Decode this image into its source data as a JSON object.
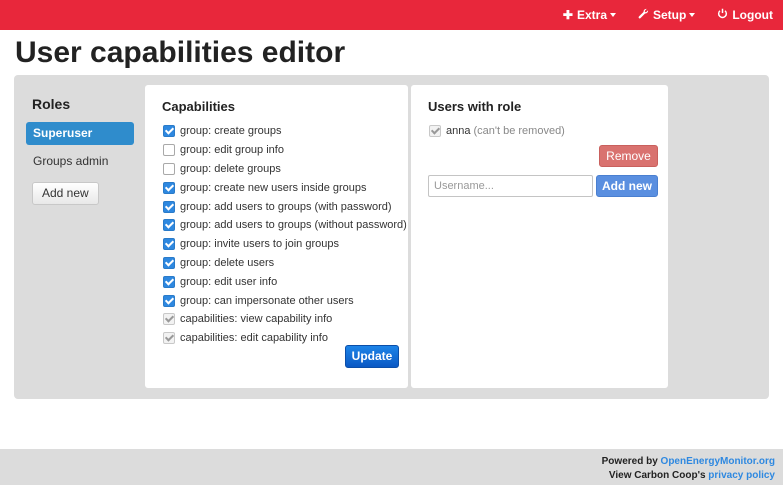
{
  "nav": {
    "extra_label": "Extra",
    "setup_label": "Setup",
    "logout_label": "Logout",
    "extra_icon": "plus-icon",
    "setup_icon": "wrench-icon",
    "logout_icon": "power-icon"
  },
  "page_title": "User capabilities editor",
  "roles": {
    "heading": "Roles",
    "items": [
      {
        "label": "Superuser",
        "active": true
      },
      {
        "label": "Groups admin",
        "active": false
      }
    ],
    "add_label": "Add new"
  },
  "capabilities": {
    "heading": "Capabilities",
    "items": [
      {
        "label": "group: create groups",
        "state": "checked"
      },
      {
        "label": "group: edit group info",
        "state": "unchecked"
      },
      {
        "label": "group: delete groups",
        "state": "unchecked"
      },
      {
        "label": "group: create new users inside groups",
        "state": "checked"
      },
      {
        "label": "group: add users to groups (with password)",
        "state": "checked"
      },
      {
        "label": "group: add users to groups (without password)",
        "state": "checked"
      },
      {
        "label": "group: invite users to join groups",
        "state": "checked"
      },
      {
        "label": "group: delete users",
        "state": "checked"
      },
      {
        "label": "group: edit user info",
        "state": "checked"
      },
      {
        "label": "group: can impersonate other users",
        "state": "checked"
      },
      {
        "label": "capabilities: view capability info",
        "state": "disabled-checked"
      },
      {
        "label": "capabilities: edit capability info",
        "state": "disabled-checked"
      }
    ],
    "update_label": "Update"
  },
  "users": {
    "heading": "Users with role",
    "user_name": "anna",
    "user_note": "(can't be removed)",
    "remove_label": "Remove",
    "input_placeholder": "Username...",
    "add_label": "Add new"
  },
  "footer": {
    "powered_prefix": "Powered by ",
    "powered_link": "OpenEnergyMonitor.org",
    "view_prefix": "View Carbon Coop's ",
    "view_link": "privacy policy"
  },
  "colors": {
    "topbar": "#e8273b",
    "accent": "#2f8ccc",
    "primary": "#0a58c4",
    "danger": "#d9726f"
  }
}
